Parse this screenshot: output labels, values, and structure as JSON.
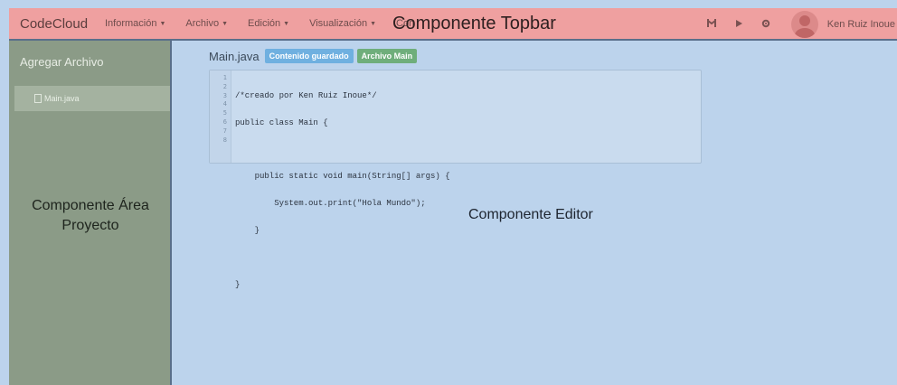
{
  "topbar": {
    "brand": "CodeCloud",
    "menus": [
      "Información",
      "Archivo",
      "Edición",
      "Visualización",
      "Con"
    ],
    "overlay_label": "Componente Topbar",
    "user_name": "Ken Ruiz Inoue",
    "icons": [
      "merge-icon",
      "play-icon",
      "settings-icon"
    ]
  },
  "sidebar": {
    "add_file_label": "Agregar Archivo",
    "files": [
      "Main.java"
    ],
    "overlay_label_line1": "Componente Área",
    "overlay_label_line2": "Proyecto"
  },
  "editor": {
    "file_name": "Main.java",
    "badge_saved": "Contenido guardado",
    "badge_main": "Archivo Main",
    "line_numbers": [
      "1",
      "2",
      "3",
      "4",
      "5",
      "6",
      "7",
      "8"
    ],
    "code_lines": [
      "/*creado por Ken Ruiz Inoue*/",
      "public class Main {",
      "",
      "    public static void main(String[] args) {",
      "        System.out.print(\"Hola Mundo\");",
      "    }",
      "",
      "}"
    ],
    "overlay_label": "Componente Editor"
  },
  "colors": {
    "topbar_bg": "#efa0a0",
    "sidebar_bg": "#8b9b87",
    "editor_bg": "#bcd3ec",
    "badge_saved": "#6fb0e0",
    "badge_main": "#6fae7b"
  }
}
